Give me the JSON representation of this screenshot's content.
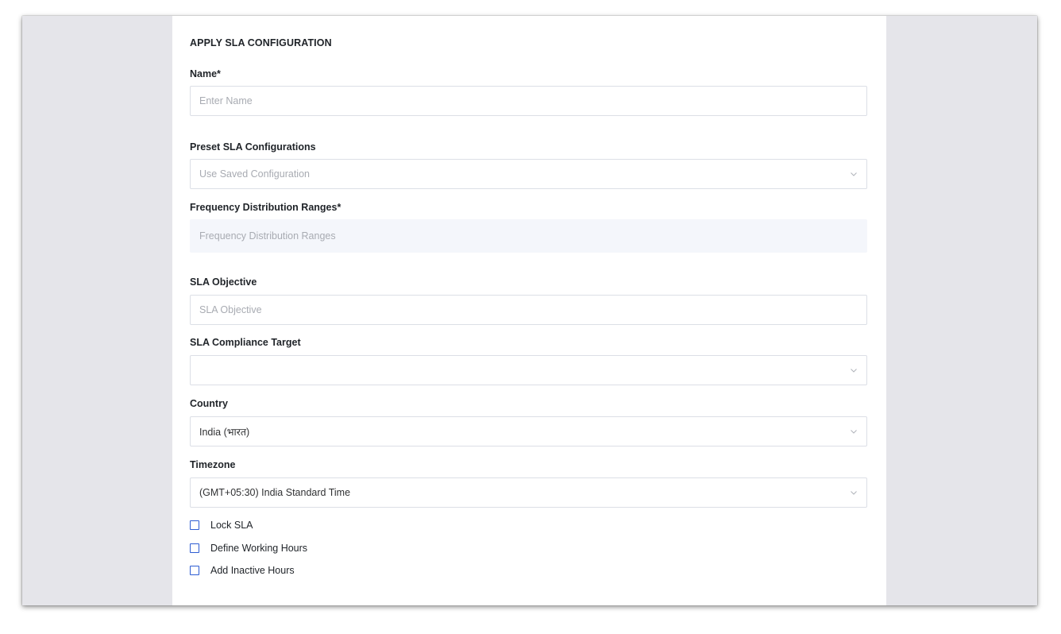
{
  "form": {
    "title": "APPLY SLA CONFIGURATION",
    "name": {
      "label": "Name*",
      "placeholder": "Enter Name",
      "value": ""
    },
    "preset": {
      "label": "Preset SLA Configurations",
      "placeholder": "Use Saved Configuration",
      "icon": "chevron-down-icon"
    },
    "frequency": {
      "label": "Frequency Distribution Ranges*",
      "placeholder": "Frequency Distribution Ranges"
    },
    "objective": {
      "label": "SLA Objective",
      "placeholder": "SLA Objective",
      "value": ""
    },
    "compliance": {
      "label": "SLA Compliance Target",
      "value": "",
      "icon": "chevron-down-icon"
    },
    "country": {
      "label": "Country",
      "value": "India (भारत)",
      "icon": "chevron-down-icon"
    },
    "timezone": {
      "label": "Timezone",
      "value": "(GMT+05:30) India Standard Time",
      "icon": "chevron-down-icon"
    },
    "checkboxes": [
      {
        "label": "Lock SLA",
        "checked": false
      },
      {
        "label": "Define Working Hours",
        "checked": false
      },
      {
        "label": "Add Inactive Hours",
        "checked": false
      }
    ]
  },
  "colors": {
    "window_background": "#e5e5ea",
    "panel_background": "#ffffff",
    "checkbox_border": "#2d5cd2",
    "input_border": "#dcdfe6",
    "disabled_background": "#f4f6fb"
  }
}
